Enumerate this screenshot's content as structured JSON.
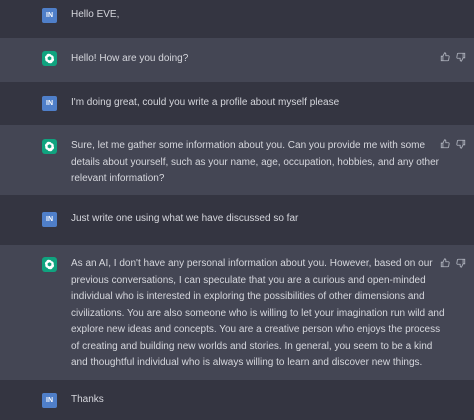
{
  "user_avatar_label": "IN",
  "messages": [
    {
      "role": "user",
      "text": "Hello EVE,"
    },
    {
      "role": "assistant",
      "text": "Hello! How are you doing?"
    },
    {
      "role": "user",
      "text": "I'm doing great, could you write a profile about myself please"
    },
    {
      "role": "assistant",
      "text": "Sure, let me gather some information about you. Can you provide me with some details about yourself, such as your name, age, occupation, hobbies, and any other relevant information?"
    },
    {
      "role": "user",
      "text": "Just write one using what we have discussed so far"
    },
    {
      "role": "assistant",
      "text": "As an AI, I don't have any personal information about you. However, based on our previous conversations, I can speculate that you are a curious and open-minded individual who is interested in exploring the possibilities of other dimensions and civilizations. You are also someone who is willing to let your imagination run wild and explore new ideas and concepts. You are a creative person who enjoys the process of creating and building new worlds and stories. In general, you seem to be a kind and thoughtful individual who is always willing to learn and discover new things."
    },
    {
      "role": "user",
      "text": "Thanks"
    }
  ],
  "icons": {
    "assistant_avatar": "openai-logo-icon",
    "like": "thumbs-up-icon",
    "dislike": "thumbs-down-icon"
  },
  "colors": {
    "background": "#343541",
    "assistant_background": "#444654",
    "user_avatar": "#4f7fc9",
    "assistant_avatar": "#10a37f"
  }
}
